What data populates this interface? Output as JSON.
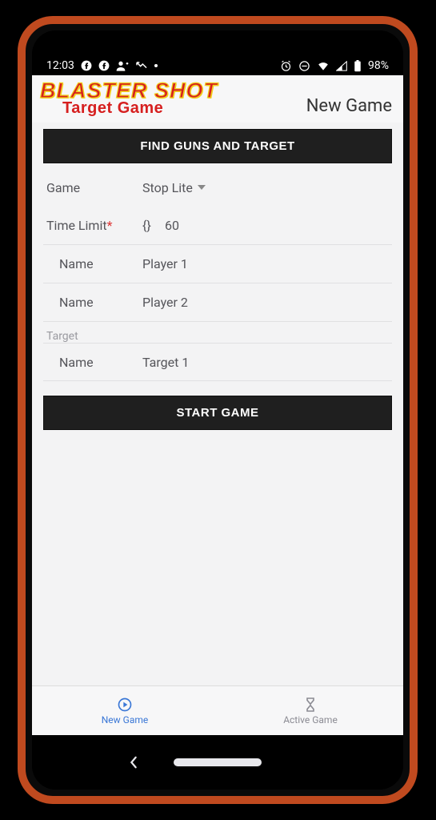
{
  "status": {
    "time": "12:03",
    "battery": "98%"
  },
  "header": {
    "logo_main": "BLASTER SHOT",
    "logo_sub": "Target Game",
    "page_title": "New Game"
  },
  "buttons": {
    "find": "FIND GUNS AND TARGET",
    "start": "START GAME"
  },
  "form": {
    "game_label": "Game",
    "game_value": "Stop Lite",
    "time_limit_label": "Time Limit",
    "time_marker": "{}",
    "time_limit_value": "60",
    "name_label": "Name",
    "player1": "Player 1",
    "player2": "Player 2",
    "target_section": "Target",
    "target1": "Target 1"
  },
  "tabs": {
    "new_game": "New Game",
    "active_game": "Active Game"
  }
}
